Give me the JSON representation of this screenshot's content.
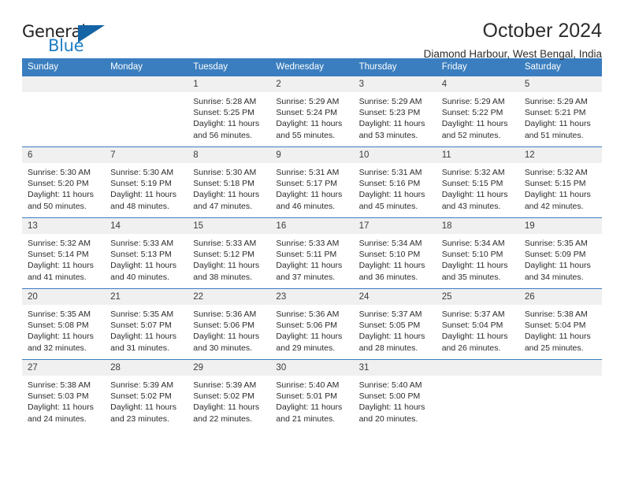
{
  "logo": {
    "word_one": "General",
    "word_two": "Blue",
    "triangle_icon": "triangle-icon"
  },
  "header": {
    "title": "October 2024",
    "location": "Diamond Harbour, West Bengal, India"
  },
  "colors": {
    "header_blue": "#3a7ebf",
    "daynum_gray": "#f0f0f0",
    "logo_blue": "#1f7fc4",
    "logo_triangle": "#1464a5",
    "text": "#2b2b2b"
  },
  "weekday_headers": [
    "Sunday",
    "Monday",
    "Tuesday",
    "Wednesday",
    "Thursday",
    "Friday",
    "Saturday"
  ],
  "weeks": [
    [
      {
        "day": "",
        "blank": true,
        "sunrise": "",
        "sunset": "",
        "daylight": ""
      },
      {
        "day": "",
        "blank": true,
        "sunrise": "",
        "sunset": "",
        "daylight": ""
      },
      {
        "day": "1",
        "sunrise": "Sunrise: 5:28 AM",
        "sunset": "Sunset: 5:25 PM",
        "daylight": "Daylight: 11 hours and 56 minutes."
      },
      {
        "day": "2",
        "sunrise": "Sunrise: 5:29 AM",
        "sunset": "Sunset: 5:24 PM",
        "daylight": "Daylight: 11 hours and 55 minutes."
      },
      {
        "day": "3",
        "sunrise": "Sunrise: 5:29 AM",
        "sunset": "Sunset: 5:23 PM",
        "daylight": "Daylight: 11 hours and 53 minutes."
      },
      {
        "day": "4",
        "sunrise": "Sunrise: 5:29 AM",
        "sunset": "Sunset: 5:22 PM",
        "daylight": "Daylight: 11 hours and 52 minutes."
      },
      {
        "day": "5",
        "sunrise": "Sunrise: 5:29 AM",
        "sunset": "Sunset: 5:21 PM",
        "daylight": "Daylight: 11 hours and 51 minutes."
      }
    ],
    [
      {
        "day": "6",
        "sunrise": "Sunrise: 5:30 AM",
        "sunset": "Sunset: 5:20 PM",
        "daylight": "Daylight: 11 hours and 50 minutes."
      },
      {
        "day": "7",
        "sunrise": "Sunrise: 5:30 AM",
        "sunset": "Sunset: 5:19 PM",
        "daylight": "Daylight: 11 hours and 48 minutes."
      },
      {
        "day": "8",
        "sunrise": "Sunrise: 5:30 AM",
        "sunset": "Sunset: 5:18 PM",
        "daylight": "Daylight: 11 hours and 47 minutes."
      },
      {
        "day": "9",
        "sunrise": "Sunrise: 5:31 AM",
        "sunset": "Sunset: 5:17 PM",
        "daylight": "Daylight: 11 hours and 46 minutes."
      },
      {
        "day": "10",
        "sunrise": "Sunrise: 5:31 AM",
        "sunset": "Sunset: 5:16 PM",
        "daylight": "Daylight: 11 hours and 45 minutes."
      },
      {
        "day": "11",
        "sunrise": "Sunrise: 5:32 AM",
        "sunset": "Sunset: 5:15 PM",
        "daylight": "Daylight: 11 hours and 43 minutes."
      },
      {
        "day": "12",
        "sunrise": "Sunrise: 5:32 AM",
        "sunset": "Sunset: 5:15 PM",
        "daylight": "Daylight: 11 hours and 42 minutes."
      }
    ],
    [
      {
        "day": "13",
        "sunrise": "Sunrise: 5:32 AM",
        "sunset": "Sunset: 5:14 PM",
        "daylight": "Daylight: 11 hours and 41 minutes."
      },
      {
        "day": "14",
        "sunrise": "Sunrise: 5:33 AM",
        "sunset": "Sunset: 5:13 PM",
        "daylight": "Daylight: 11 hours and 40 minutes."
      },
      {
        "day": "15",
        "sunrise": "Sunrise: 5:33 AM",
        "sunset": "Sunset: 5:12 PM",
        "daylight": "Daylight: 11 hours and 38 minutes."
      },
      {
        "day": "16",
        "sunrise": "Sunrise: 5:33 AM",
        "sunset": "Sunset: 5:11 PM",
        "daylight": "Daylight: 11 hours and 37 minutes."
      },
      {
        "day": "17",
        "sunrise": "Sunrise: 5:34 AM",
        "sunset": "Sunset: 5:10 PM",
        "daylight": "Daylight: 11 hours and 36 minutes."
      },
      {
        "day": "18",
        "sunrise": "Sunrise: 5:34 AM",
        "sunset": "Sunset: 5:10 PM",
        "daylight": "Daylight: 11 hours and 35 minutes."
      },
      {
        "day": "19",
        "sunrise": "Sunrise: 5:35 AM",
        "sunset": "Sunset: 5:09 PM",
        "daylight": "Daylight: 11 hours and 34 minutes."
      }
    ],
    [
      {
        "day": "20",
        "sunrise": "Sunrise: 5:35 AM",
        "sunset": "Sunset: 5:08 PM",
        "daylight": "Daylight: 11 hours and 32 minutes."
      },
      {
        "day": "21",
        "sunrise": "Sunrise: 5:35 AM",
        "sunset": "Sunset: 5:07 PM",
        "daylight": "Daylight: 11 hours and 31 minutes."
      },
      {
        "day": "22",
        "sunrise": "Sunrise: 5:36 AM",
        "sunset": "Sunset: 5:06 PM",
        "daylight": "Daylight: 11 hours and 30 minutes."
      },
      {
        "day": "23",
        "sunrise": "Sunrise: 5:36 AM",
        "sunset": "Sunset: 5:06 PM",
        "daylight": "Daylight: 11 hours and 29 minutes."
      },
      {
        "day": "24",
        "sunrise": "Sunrise: 5:37 AM",
        "sunset": "Sunset: 5:05 PM",
        "daylight": "Daylight: 11 hours and 28 minutes."
      },
      {
        "day": "25",
        "sunrise": "Sunrise: 5:37 AM",
        "sunset": "Sunset: 5:04 PM",
        "daylight": "Daylight: 11 hours and 26 minutes."
      },
      {
        "day": "26",
        "sunrise": "Sunrise: 5:38 AM",
        "sunset": "Sunset: 5:04 PM",
        "daylight": "Daylight: 11 hours and 25 minutes."
      }
    ],
    [
      {
        "day": "27",
        "sunrise": "Sunrise: 5:38 AM",
        "sunset": "Sunset: 5:03 PM",
        "daylight": "Daylight: 11 hours and 24 minutes."
      },
      {
        "day": "28",
        "sunrise": "Sunrise: 5:39 AM",
        "sunset": "Sunset: 5:02 PM",
        "daylight": "Daylight: 11 hours and 23 minutes."
      },
      {
        "day": "29",
        "sunrise": "Sunrise: 5:39 AM",
        "sunset": "Sunset: 5:02 PM",
        "daylight": "Daylight: 11 hours and 22 minutes."
      },
      {
        "day": "30",
        "sunrise": "Sunrise: 5:40 AM",
        "sunset": "Sunset: 5:01 PM",
        "daylight": "Daylight: 11 hours and 21 minutes."
      },
      {
        "day": "31",
        "sunrise": "Sunrise: 5:40 AM",
        "sunset": "Sunset: 5:00 PM",
        "daylight": "Daylight: 11 hours and 20 minutes."
      },
      {
        "day": "",
        "blank": true,
        "sunrise": "",
        "sunset": "",
        "daylight": ""
      },
      {
        "day": "",
        "blank": true,
        "sunrise": "",
        "sunset": "",
        "daylight": ""
      }
    ]
  ]
}
